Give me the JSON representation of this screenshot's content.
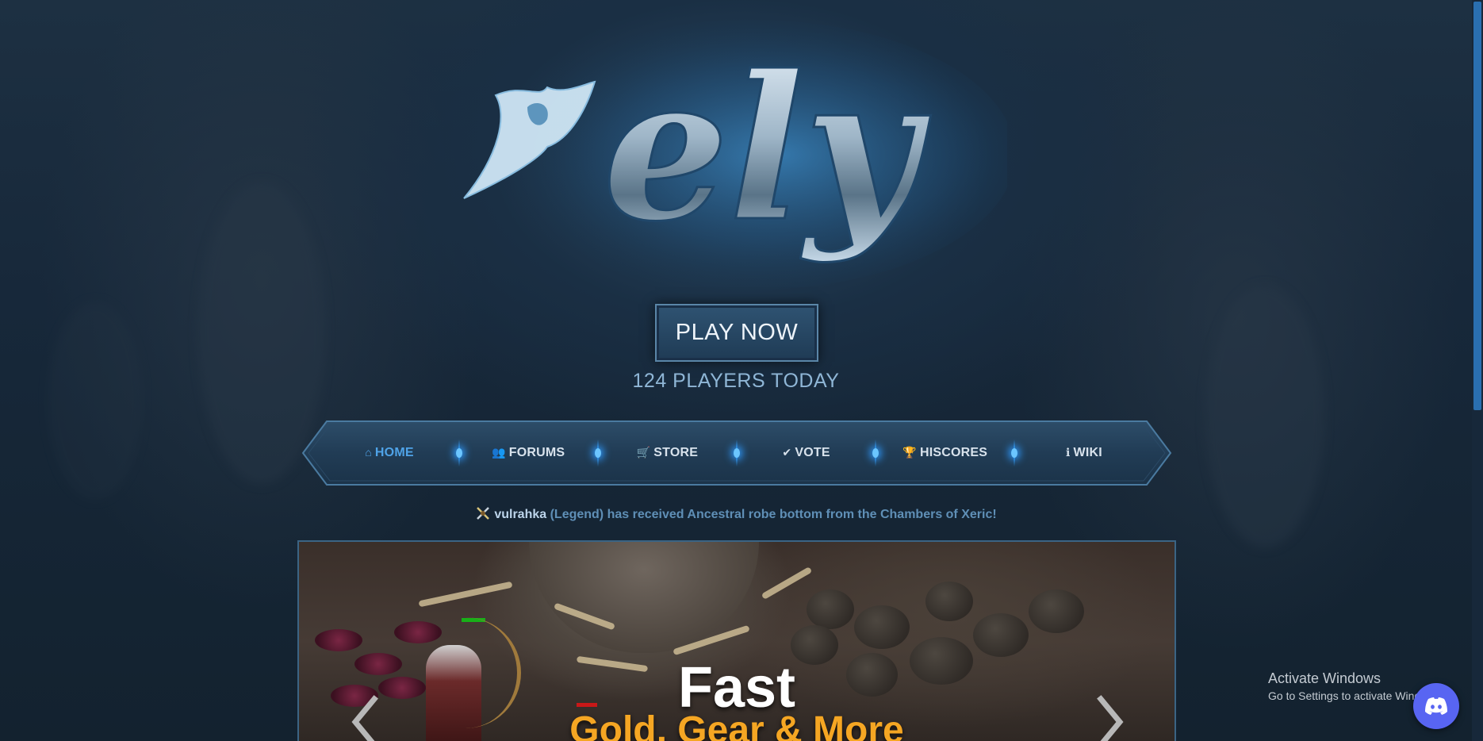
{
  "logo": {
    "text": "ely",
    "alt": "ely logo"
  },
  "hero": {
    "play_button": "PLAY NOW",
    "players_today": "124 PLAYERS TODAY"
  },
  "nav": {
    "items": [
      {
        "label": "HOME",
        "icon": "home-icon",
        "glyph": "⌂",
        "active": true
      },
      {
        "label": "FORUMS",
        "icon": "users-icon",
        "glyph": "👥",
        "active": false
      },
      {
        "label": "STORE",
        "icon": "shopping-cart-icon",
        "glyph": "🛒",
        "active": false
      },
      {
        "label": "VOTE",
        "icon": "check-icon",
        "glyph": "✔",
        "active": false
      },
      {
        "label": "HISCORES",
        "icon": "trophy-icon",
        "glyph": "🏆",
        "active": false
      },
      {
        "label": "WIKI",
        "icon": "info-circle-icon",
        "glyph": "ℹ",
        "active": false
      }
    ]
  },
  "ticker": {
    "icon": "crossed-swords-icon",
    "username": "vulrahka",
    "message": " (Legend) has received Ancestral robe bottom from the Chambers of Xeric!"
  },
  "banner": {
    "title_line1": "Fast",
    "title_line2": "Gold, Gear & More",
    "prev_icon": "chevron-left-icon",
    "next_icon": "chevron-right-icon"
  },
  "os_overlay": {
    "title": "Activate Windows",
    "subtitle": "Go to Settings to activate Windows."
  },
  "colors": {
    "accent": "#4fa3e8",
    "nav_text": "#d8e2ec",
    "ticker_text": "#5f8fb6",
    "banner_highlight": "#f5a623",
    "discord": "#5865f2"
  }
}
